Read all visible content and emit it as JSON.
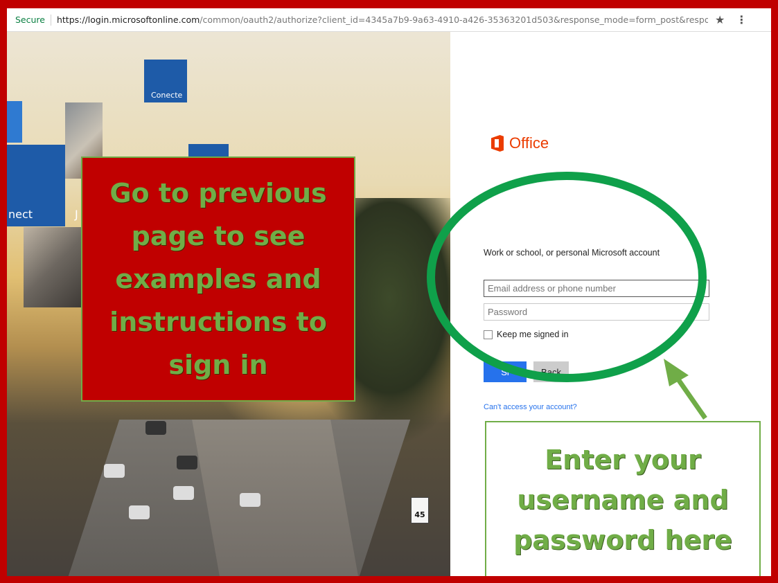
{
  "browser": {
    "secure_label": "Secure",
    "url_host": "https://login.microsoftonline.com",
    "url_path": "/common/oauth2/authorize?client_id=4345a7b9-9a63-4910-a426-35363201d503&response_mode=form_post&response_type=cod...",
    "star_icon": "★",
    "menu_icon": "⋮"
  },
  "hero": {
    "tile_conecte": "Conecte",
    "tile_nect": "nect",
    "tile_j": "J",
    "sign_speed": "45"
  },
  "notes": {
    "left_note": "Go to previous\npage to see\nexamples and\ninstructions to\nsign in",
    "right_note": "Enter your\nusername and\npassword here"
  },
  "login": {
    "brand": "Office",
    "account_label": "Work or school, or personal Microsoft account",
    "email_placeholder": "Email address or phone number",
    "password_placeholder": "Password",
    "keep_signed_in": "Keep me signed in",
    "signin_button": "Si",
    "back_button": "Back",
    "cant_access": "Can't access your account?"
  },
  "colors": {
    "frame": "#c00000",
    "annotation_green": "#70ad47",
    "office_orange": "#eb3c00",
    "signin_blue": "#2672ec"
  }
}
